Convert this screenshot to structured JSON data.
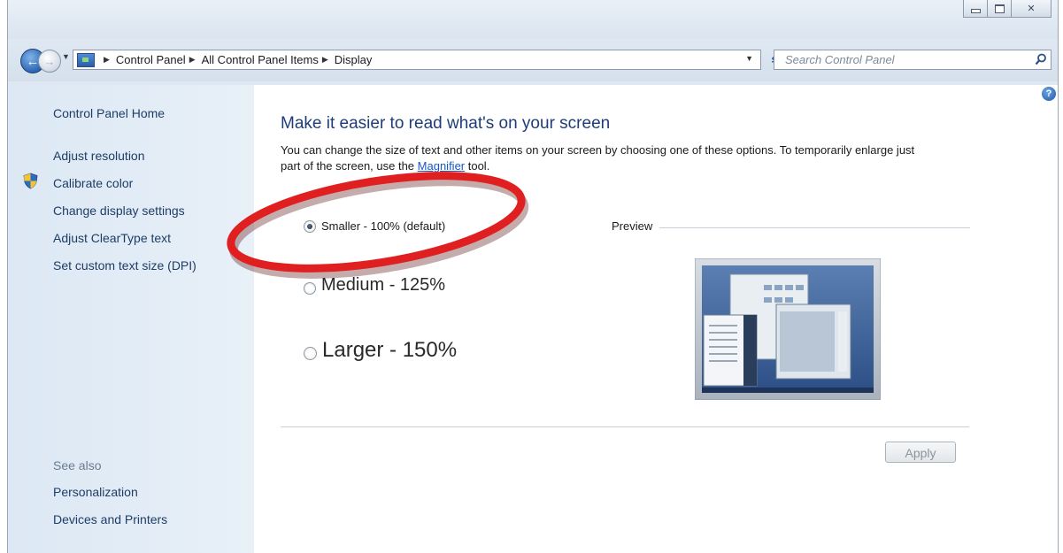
{
  "navigation": {
    "breadcrumbs": [
      "Control Panel",
      "All Control Panel Items",
      "Display"
    ],
    "search_placeholder": "Search Control Panel"
  },
  "sidebar": {
    "home_label": "Control Panel Home",
    "links": [
      "Adjust resolution",
      "Calibrate color",
      "Change display settings",
      "Adjust ClearType text",
      "Set custom text size (DPI)"
    ],
    "see_also_label": "See also",
    "see_also_links": [
      "Personalization",
      "Devices and Printers"
    ]
  },
  "main": {
    "heading": "Make it easier to read what's on your screen",
    "description_before_link": "You can change the size of text and other items on your screen by choosing one of these options. To temporarily enlarge just part of the screen, use the ",
    "magnifier_link": "Magnifier",
    "description_after_link": " tool.",
    "options": [
      {
        "label": "Smaller - 100% (default)",
        "selected": true
      },
      {
        "label": "Medium - 125%",
        "selected": false
      },
      {
        "label": "Larger - 150%",
        "selected": false
      }
    ],
    "preview_label": "Preview",
    "apply_label": "Apply",
    "apply_enabled": false
  },
  "colors": {
    "sidebar_bg": "#dce8f4",
    "link": "#1e3d66",
    "heading": "#1e3d78",
    "annotation_red": "#e02020"
  }
}
